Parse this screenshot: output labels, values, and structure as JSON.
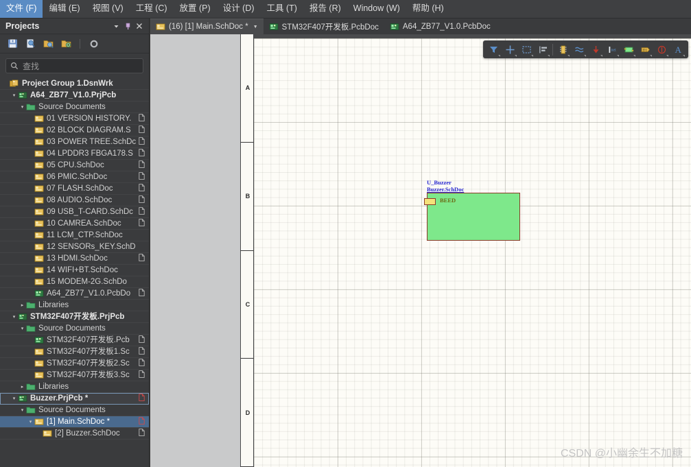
{
  "menubar": {
    "items": [
      {
        "label": "文件 (F)",
        "active": true
      },
      {
        "label": "编辑 (E)",
        "active": false
      },
      {
        "label": "视图 (V)",
        "active": false
      },
      {
        "label": "工程 (C)",
        "active": false
      },
      {
        "label": "放置 (P)",
        "active": false
      },
      {
        "label": "设计 (D)",
        "active": false
      },
      {
        "label": "工具 (T)",
        "active": false
      },
      {
        "label": "报告 (R)",
        "active": false
      },
      {
        "label": "Window (W)",
        "active": false
      },
      {
        "label": "帮助 (H)",
        "active": false
      }
    ]
  },
  "panel": {
    "title": "Projects",
    "title_buttons": [
      {
        "name": "panel-dropdown-button",
        "glyph": "▼"
      },
      {
        "name": "panel-pin-button",
        "glyph": "📌"
      },
      {
        "name": "panel-close-button",
        "glyph": "✕"
      }
    ],
    "toolbar": [
      {
        "name": "save-icon",
        "tip": "Save"
      },
      {
        "name": "compile-icon",
        "tip": "Compile"
      },
      {
        "name": "open-project-icon",
        "tip": "Open Project"
      },
      {
        "name": "project-options-icon",
        "tip": "Project Options"
      },
      {
        "name": "settings-gear-icon",
        "tip": "Settings"
      }
    ],
    "search": {
      "placeholder": "查找",
      "value": "",
      "icon": "search-icon"
    },
    "tree": [
      {
        "label": "Project Group 1.DsnWrk",
        "indent": 0,
        "icon": "workspace-icon",
        "bold": true,
        "arrow": "",
        "doc": false,
        "state": "normal"
      },
      {
        "label": "A64_ZB77_V1.0.PrjPcb",
        "indent": 1,
        "icon": "pcb-project-icon",
        "bold": true,
        "arrow": "▾",
        "doc": false,
        "state": "normal"
      },
      {
        "label": "Source Documents",
        "indent": 2,
        "icon": "folder-icon",
        "bold": false,
        "arrow": "▾",
        "doc": false,
        "state": "normal"
      },
      {
        "label": "01 VERSION HISTORY.",
        "indent": 3,
        "icon": "sch-doc-icon",
        "bold": false,
        "arrow": "",
        "doc": true,
        "state": "normal"
      },
      {
        "label": "02 BLOCK DIAGRAM.S",
        "indent": 3,
        "icon": "sch-doc-icon",
        "bold": false,
        "arrow": "",
        "doc": true,
        "state": "normal"
      },
      {
        "label": "03 POWER TREE.SchDc",
        "indent": 3,
        "icon": "sch-doc-icon",
        "bold": false,
        "arrow": "",
        "doc": true,
        "state": "normal"
      },
      {
        "label": "04 LPDDR3 FBGA178.S",
        "indent": 3,
        "icon": "sch-doc-icon",
        "bold": false,
        "arrow": "",
        "doc": true,
        "state": "normal"
      },
      {
        "label": "05 CPU.SchDoc",
        "indent": 3,
        "icon": "sch-doc-icon",
        "bold": false,
        "arrow": "",
        "doc": true,
        "state": "normal"
      },
      {
        "label": "06 PMIC.SchDoc",
        "indent": 3,
        "icon": "sch-doc-icon",
        "bold": false,
        "arrow": "",
        "doc": true,
        "state": "normal"
      },
      {
        "label": "07 FLASH.SchDoc",
        "indent": 3,
        "icon": "sch-doc-icon",
        "bold": false,
        "arrow": "",
        "doc": true,
        "state": "normal"
      },
      {
        "label": "08 AUDIO.SchDoc",
        "indent": 3,
        "icon": "sch-doc-icon",
        "bold": false,
        "arrow": "",
        "doc": true,
        "state": "normal"
      },
      {
        "label": "09 USB_T-CARD.SchDc",
        "indent": 3,
        "icon": "sch-doc-icon",
        "bold": false,
        "arrow": "",
        "doc": true,
        "state": "normal"
      },
      {
        "label": "10 CAMREA.SchDoc",
        "indent": 3,
        "icon": "sch-doc-icon",
        "bold": false,
        "arrow": "",
        "doc": true,
        "state": "normal"
      },
      {
        "label": "11 LCM_CTP.SchDoc",
        "indent": 3,
        "icon": "sch-doc-icon",
        "bold": false,
        "arrow": "",
        "doc": false,
        "state": "normal"
      },
      {
        "label": "12 SENSORs_KEY.SchD",
        "indent": 3,
        "icon": "sch-doc-icon",
        "bold": false,
        "arrow": "",
        "doc": false,
        "state": "normal"
      },
      {
        "label": "13 HDMI.SchDoc",
        "indent": 3,
        "icon": "sch-doc-icon",
        "bold": false,
        "arrow": "",
        "doc": true,
        "state": "normal"
      },
      {
        "label": "14 WIFI+BT.SchDoc",
        "indent": 3,
        "icon": "sch-doc-icon",
        "bold": false,
        "arrow": "",
        "doc": false,
        "state": "normal"
      },
      {
        "label": "15 MODEM-2G.SchDo",
        "indent": 3,
        "icon": "sch-doc-icon",
        "bold": false,
        "arrow": "",
        "doc": false,
        "state": "normal"
      },
      {
        "label": "A64_ZB77_V1.0.PcbDo",
        "indent": 3,
        "icon": "pcb-doc-icon",
        "bold": false,
        "arrow": "",
        "doc": true,
        "state": "normal"
      },
      {
        "label": "Libraries",
        "indent": 2,
        "icon": "folder-icon",
        "bold": false,
        "arrow": "▸",
        "doc": false,
        "state": "normal"
      },
      {
        "label": "STM32F407开发板.PrjPcb",
        "indent": 1,
        "icon": "pcb-project-icon",
        "bold": true,
        "arrow": "▾",
        "doc": false,
        "state": "normal"
      },
      {
        "label": "Source Documents",
        "indent": 2,
        "icon": "folder-icon",
        "bold": false,
        "arrow": "▾",
        "doc": false,
        "state": "normal"
      },
      {
        "label": "STM32F407开发板.Pcb",
        "indent": 3,
        "icon": "pcb-doc-icon",
        "bold": false,
        "arrow": "",
        "doc": true,
        "state": "normal"
      },
      {
        "label": "STM32F407开发板1.Sc",
        "indent": 3,
        "icon": "sch-doc-icon",
        "bold": false,
        "arrow": "",
        "doc": true,
        "state": "normal"
      },
      {
        "label": "STM32F407开发板2.Sc",
        "indent": 3,
        "icon": "sch-doc-icon",
        "bold": false,
        "arrow": "",
        "doc": true,
        "state": "normal"
      },
      {
        "label": "STM32F407开发板3.Sc",
        "indent": 3,
        "icon": "sch-doc-icon",
        "bold": false,
        "arrow": "",
        "doc": true,
        "state": "normal"
      },
      {
        "label": "Libraries",
        "indent": 2,
        "icon": "folder-icon",
        "bold": false,
        "arrow": "▸",
        "doc": false,
        "state": "normal"
      },
      {
        "label": "Buzzer.PrjPcb *",
        "indent": 1,
        "icon": "pcb-project-icon",
        "bold": true,
        "arrow": "▾",
        "doc": true,
        "doc_modified": true,
        "state": "focus"
      },
      {
        "label": "Source Documents",
        "indent": 2,
        "icon": "folder-icon",
        "bold": false,
        "arrow": "▾",
        "doc": false,
        "state": "normal"
      },
      {
        "label": "[1] Main.SchDoc *",
        "indent": 3,
        "icon": "sch-doc-icon",
        "bold": false,
        "arrow": "▾",
        "doc": true,
        "doc_modified": true,
        "state": "selected"
      },
      {
        "label": "[2] Buzzer.SchDoc",
        "indent": 4,
        "icon": "sch-doc-icon",
        "bold": false,
        "arrow": "",
        "doc": true,
        "state": "normal"
      }
    ]
  },
  "tabs": [
    {
      "label": "(16) [1] Main.SchDoc *",
      "icon": "sch-doc-icon",
      "active": true,
      "caret": "▾"
    },
    {
      "label": "STM32F407开发板.PcbDoc",
      "icon": "pcb-doc-icon",
      "active": false,
      "caret": ""
    },
    {
      "label": "A64_ZB77_V1.0.PcbDoc",
      "icon": "pcb-doc-icon",
      "active": false,
      "caret": ""
    }
  ],
  "editor": {
    "ruler_labels": [
      "A",
      "B",
      "C",
      "D"
    ],
    "float_toolbar": [
      {
        "name": "filter-icon"
      },
      {
        "name": "crosshair-icon"
      },
      {
        "name": "select-rectangle-icon"
      },
      {
        "name": "align-icon"
      },
      {
        "name": "component-icon"
      },
      {
        "name": "wire-icon"
      },
      {
        "name": "ground-icon"
      },
      {
        "name": "net-label-icon"
      },
      {
        "name": "sheet-symbol-icon"
      },
      {
        "name": "port-icon"
      },
      {
        "name": "no-erc-icon"
      },
      {
        "name": "text-icon",
        "glyph": "A"
      }
    ],
    "sheet_symbol": {
      "designator": "U_Buzzer",
      "filename": "Buzzer.SchDoc",
      "port_label": "BEED",
      "body_color": "#7ee88b",
      "border_color": "#8b3a28",
      "port_color": "#f5e27a",
      "text_color": "#2a2ad0",
      "port_text_color": "#6b6b14"
    }
  },
  "watermark": "CSDN @小幽余生不加糖"
}
